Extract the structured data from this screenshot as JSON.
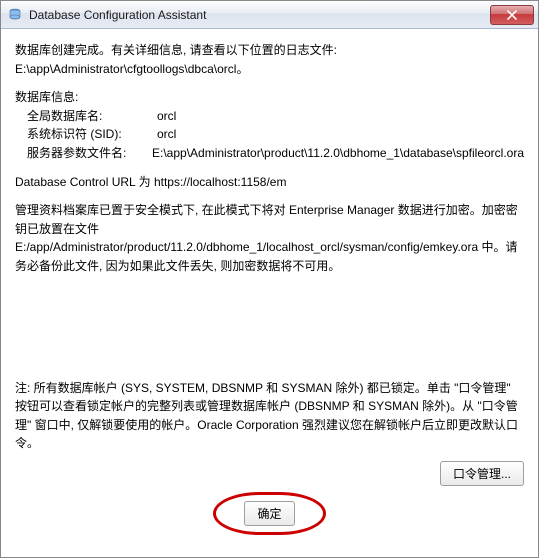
{
  "window": {
    "title": "Database Configuration Assistant"
  },
  "body": {
    "completion_line": "数据库创建完成。有关详细信息, 请查看以下位置的日志文件:",
    "log_path": " E:\\app\\Administrator\\cfgtoollogs\\dbca\\orcl。",
    "db_info_heading": "数据库信息:",
    "rows": {
      "global_db_name_label": "全局数据库名:",
      "global_db_name_value": "orcl",
      "sid_label": "系统标识符 (SID):",
      "sid_value": "orcl",
      "spfile_label": "服务器参数文件名:",
      "spfile_value": "E:\\app\\Administrator\\product\\11.2.0\\dbhome_1\\database\\spfileorcl.ora"
    },
    "db_control_url": "Database Control URL 为 https://localhost:1158/em",
    "em_note": "管理资料档案库已置于安全模式下, 在此模式下将对 Enterprise Manager 数据进行加密。加密密钥已放置在文件 E:/app/Administrator/product/11.2.0/dbhome_1/localhost_orcl/sysman/config/emkey.ora 中。请务必备份此文件, 因为如果此文件丢失, 则加密数据将不可用。",
    "accounts_note": "注: 所有数据库帐户 (SYS, SYSTEM, DBSNMP 和 SYSMAN 除外) 都已锁定。单击 \"口令管理\" 按钮可以查看锁定帐户的完整列表或管理数据库帐户 (DBSNMP 和 SYSMAN 除外)。从 \"口令管理\" 窗口中, 仅解锁要使用的帐户。Oracle Corporation 强烈建议您在解锁帐户后立即更改默认口令。"
  },
  "buttons": {
    "password_mgmt": "口令管理...",
    "ok": "确定"
  }
}
